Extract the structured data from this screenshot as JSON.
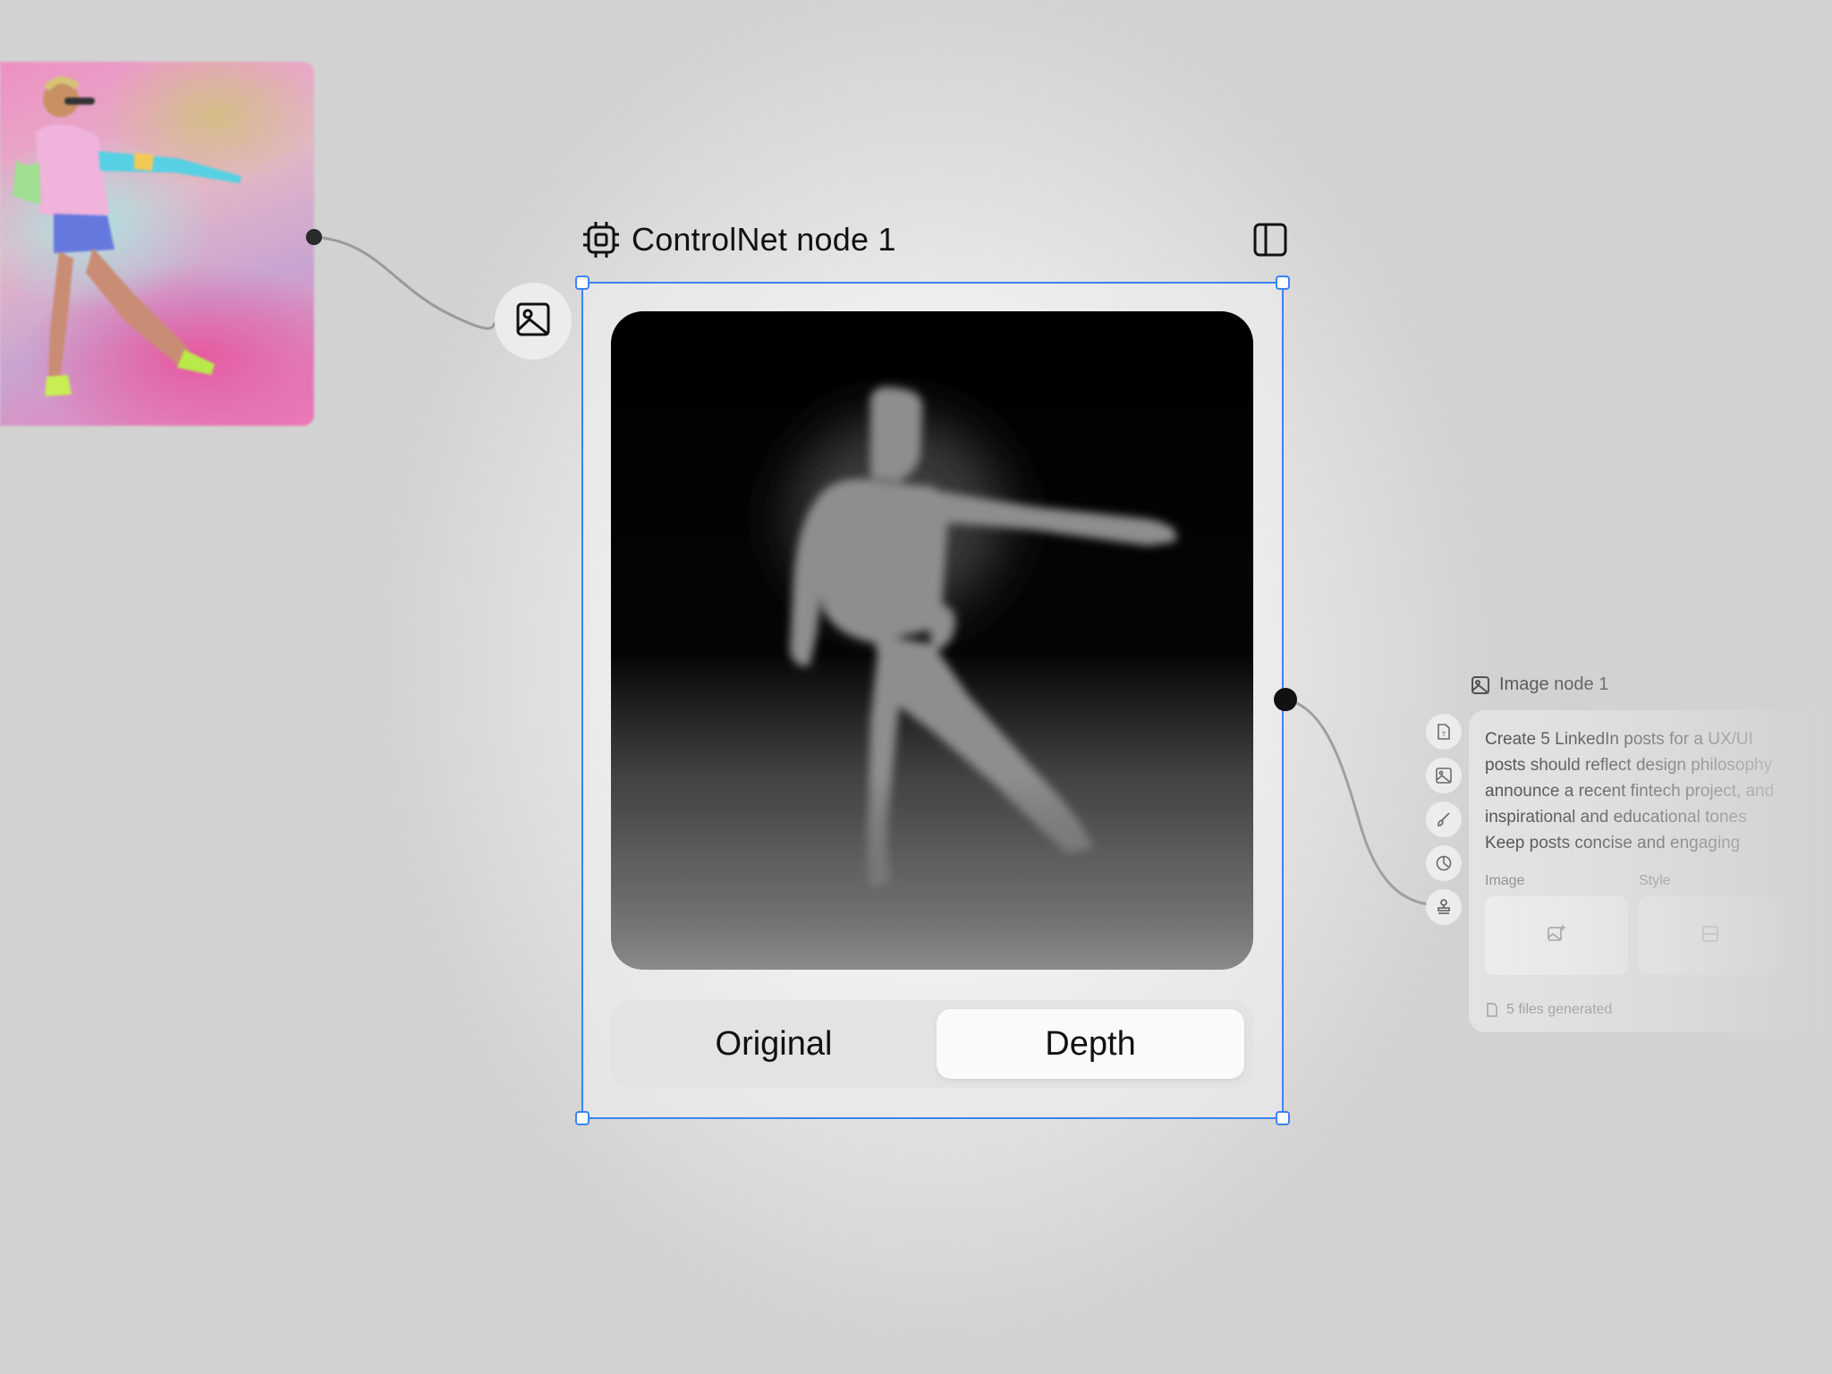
{
  "canvas": {
    "main_node": {
      "title": "ControlNet node 1",
      "header_icon": "chip-icon",
      "panel_toggle_icon": "sidebar-toggle-icon",
      "input_button_icon": "image-icon",
      "tabs": [
        {
          "label": "Original",
          "active": false
        },
        {
          "label": "Depth",
          "active": true
        }
      ]
    },
    "image_node": {
      "title": "Image node 1",
      "title_icon": "image-icon",
      "tools": [
        "text-file-icon",
        "image-icon",
        "brush-icon",
        "timer-icon",
        "stamp-icon"
      ],
      "prompt_lines": [
        "Create 5 LinkedIn posts for a UX/UI",
        "posts should reflect design philosophy",
        "announce a recent fintech project, and",
        "inspirational and educational tones",
        "Keep posts concise and engaging"
      ],
      "image_label": "Image",
      "style_label": "Style",
      "files_text": "5 files generated"
    }
  },
  "colors": {
    "selection": "#3b82f6",
    "background": "#d1d1d1"
  }
}
